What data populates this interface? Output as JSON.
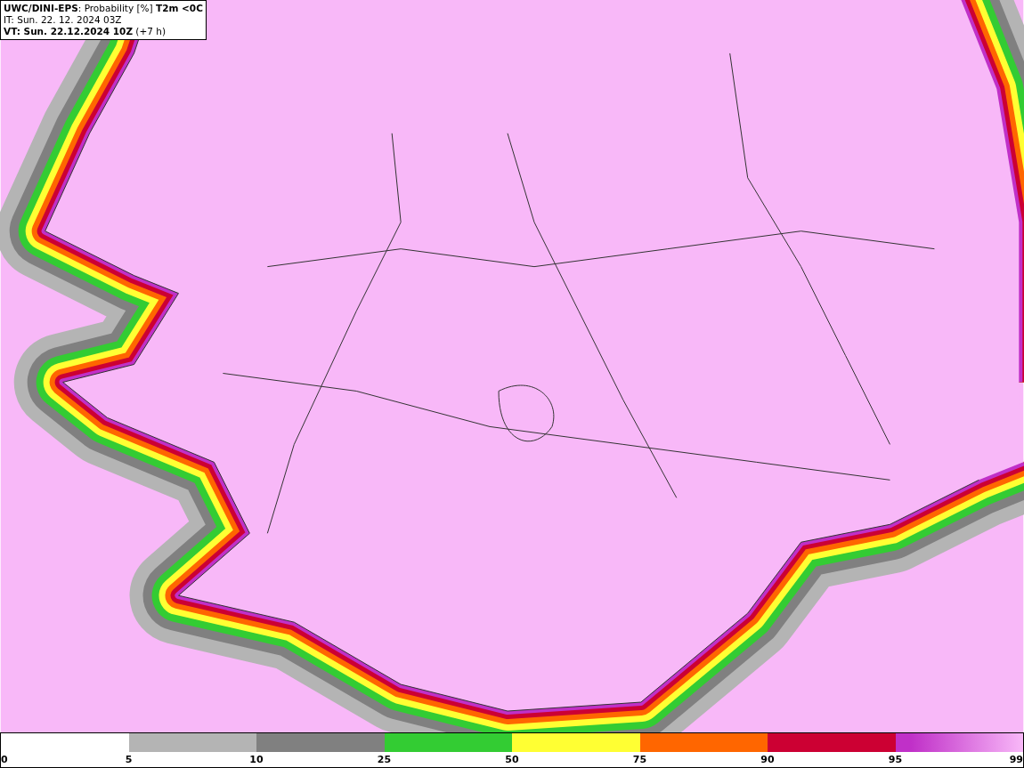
{
  "header": {
    "lines": [
      "**UWC/DINI-EPS**: Probability [%] **T2m <0C**",
      "IT: Sun. 22. 12. 2024 03Z",
      "**VT: Sun. 22.12.2024 10Z** (+7 h)"
    ]
  },
  "legend": {
    "segments": [
      {
        "kind": "blank"
      },
      {
        "color": "#b4b4b4"
      },
      {
        "color": "#808080"
      },
      {
        "color": "#33cc33"
      },
      {
        "color": "#ffff33"
      },
      {
        "color": "#ff6600"
      },
      {
        "color": "#cc0033"
      },
      {
        "color": "#c030c8",
        "kind": "gradient"
      }
    ],
    "ticks": [
      "0",
      "5",
      "10",
      "25",
      "50",
      "75",
      "90",
      "95",
      "99"
    ]
  }
}
